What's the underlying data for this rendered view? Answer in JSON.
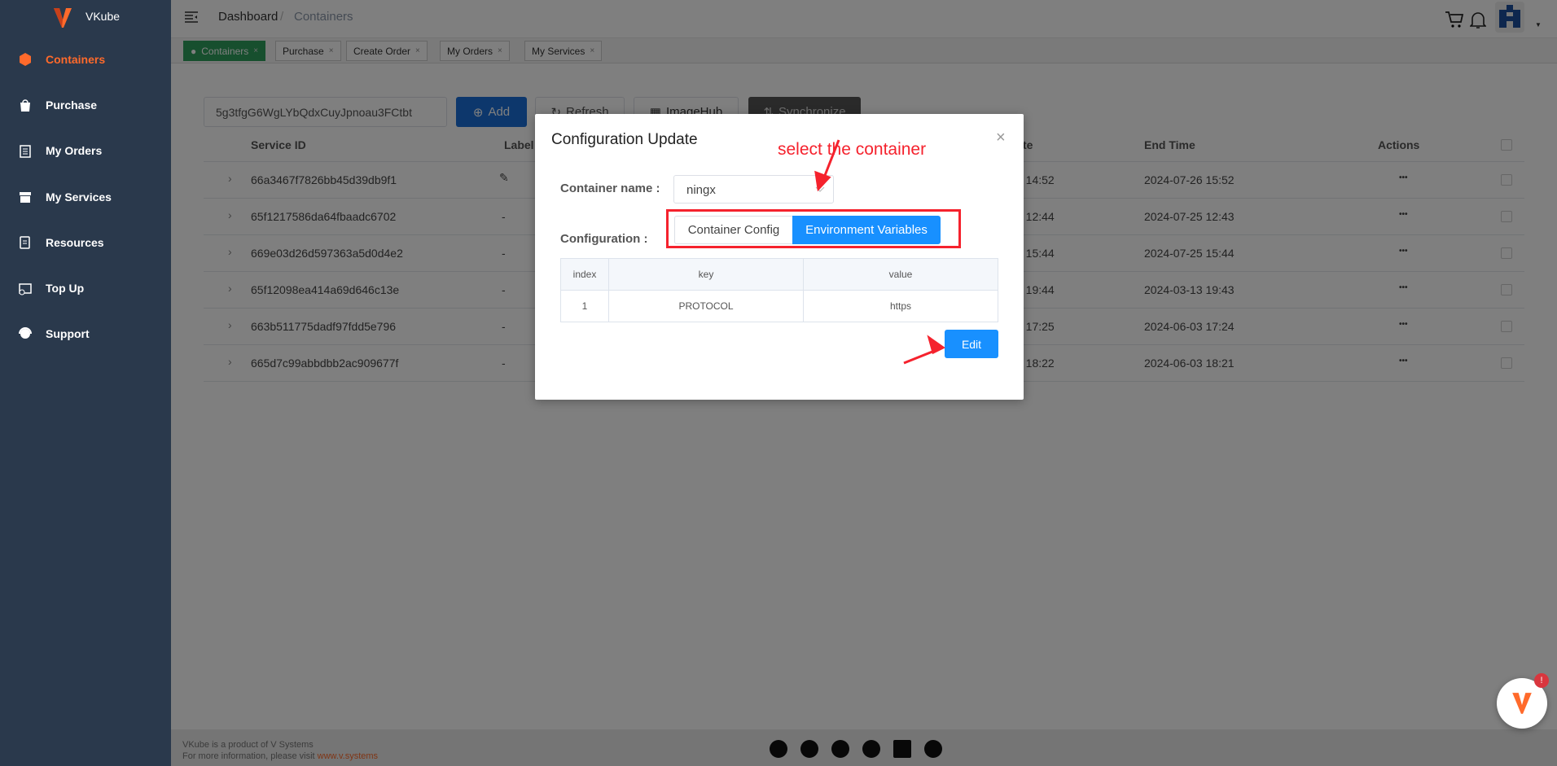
{
  "app": {
    "brand": "VKube",
    "accent": "#ff6a2b",
    "primary": "#1890ff"
  },
  "sidebar": {
    "items": [
      {
        "label": "Containers",
        "icon": "cube-icon",
        "active": true
      },
      {
        "label": "Purchase",
        "icon": "bag-icon"
      },
      {
        "label": "My Orders",
        "icon": "clipboard-icon"
      },
      {
        "label": "My Services",
        "icon": "store-icon"
      },
      {
        "label": "Resources",
        "icon": "document-icon"
      },
      {
        "label": "Top Up",
        "icon": "wallet-icon"
      },
      {
        "label": "Support",
        "icon": "headset-icon"
      }
    ]
  },
  "header": {
    "breadcrumb": [
      "Dashboard",
      "Containers"
    ],
    "separator": "/"
  },
  "tabs": [
    {
      "label": "Containers",
      "active": true
    },
    {
      "label": "Purchase"
    },
    {
      "label": "Create Order"
    },
    {
      "label": "My Orders"
    },
    {
      "label": "My Services"
    }
  ],
  "toolbar": {
    "search_value": "5g3tfgG6WgLYbQdxCuyJpnoau3FCtbt",
    "add": "Add",
    "refresh": "Refresh",
    "imagehub": "ImageHub",
    "synchronize": "Synchronize"
  },
  "table": {
    "headers": {
      "service_id": "Service ID",
      "label": "Label",
      "start_partial": "te",
      "end_time": "End Time",
      "actions": "Actions"
    },
    "rows": [
      {
        "id": "66a3467f7826bb45d39db9f1",
        "label": "edit-icon",
        "start": "6 14:52",
        "end": "2024-07-26 15:52"
      },
      {
        "id": "65f1217586da64fbaadc6702",
        "label": "-",
        "start": "5 12:44",
        "end": "2024-07-25 12:43"
      },
      {
        "id": "669e03d26d597363a5d0d4e2",
        "label": "-",
        "start": "5 15:44",
        "end": "2024-07-25 15:44"
      },
      {
        "id": "65f12098ea414a69d646c13e",
        "label": "-",
        "start": "3 19:44",
        "end": "2024-03-13 19:43"
      },
      {
        "id": "663b511775dadf97fdd5e796",
        "label": "-",
        "start": "3 17:25",
        "end": "2024-06-03 17:24"
      },
      {
        "id": "665d7c99abbdbb2ac909677f",
        "label": "-",
        "start": "3 18:22",
        "end": "2024-06-03 18:21"
      }
    ],
    "actions_glyph": "•••"
  },
  "modal": {
    "title": "Configuration Update",
    "container_label": "Container name :",
    "container_value": "ningx",
    "config_label": "Configuration :",
    "segments": [
      "Container Config",
      "Environment Variables"
    ],
    "active_segment": "Environment Variables",
    "env_table": {
      "headers": [
        "index",
        "key",
        "value"
      ],
      "rows": [
        [
          "1",
          "PROTOCOL",
          "https"
        ]
      ]
    },
    "edit": "Edit",
    "annotation": "select the container"
  },
  "footer": {
    "line1": "VKube is a product of V Systems",
    "line2": "For more information, please visit ",
    "link": "www.v.systems",
    "social": [
      "twitter-icon",
      "discord-icon",
      "telegram-icon",
      "reddit-icon",
      "linkedin-icon",
      "youtube-icon"
    ]
  },
  "fab": {
    "badge": "!"
  }
}
